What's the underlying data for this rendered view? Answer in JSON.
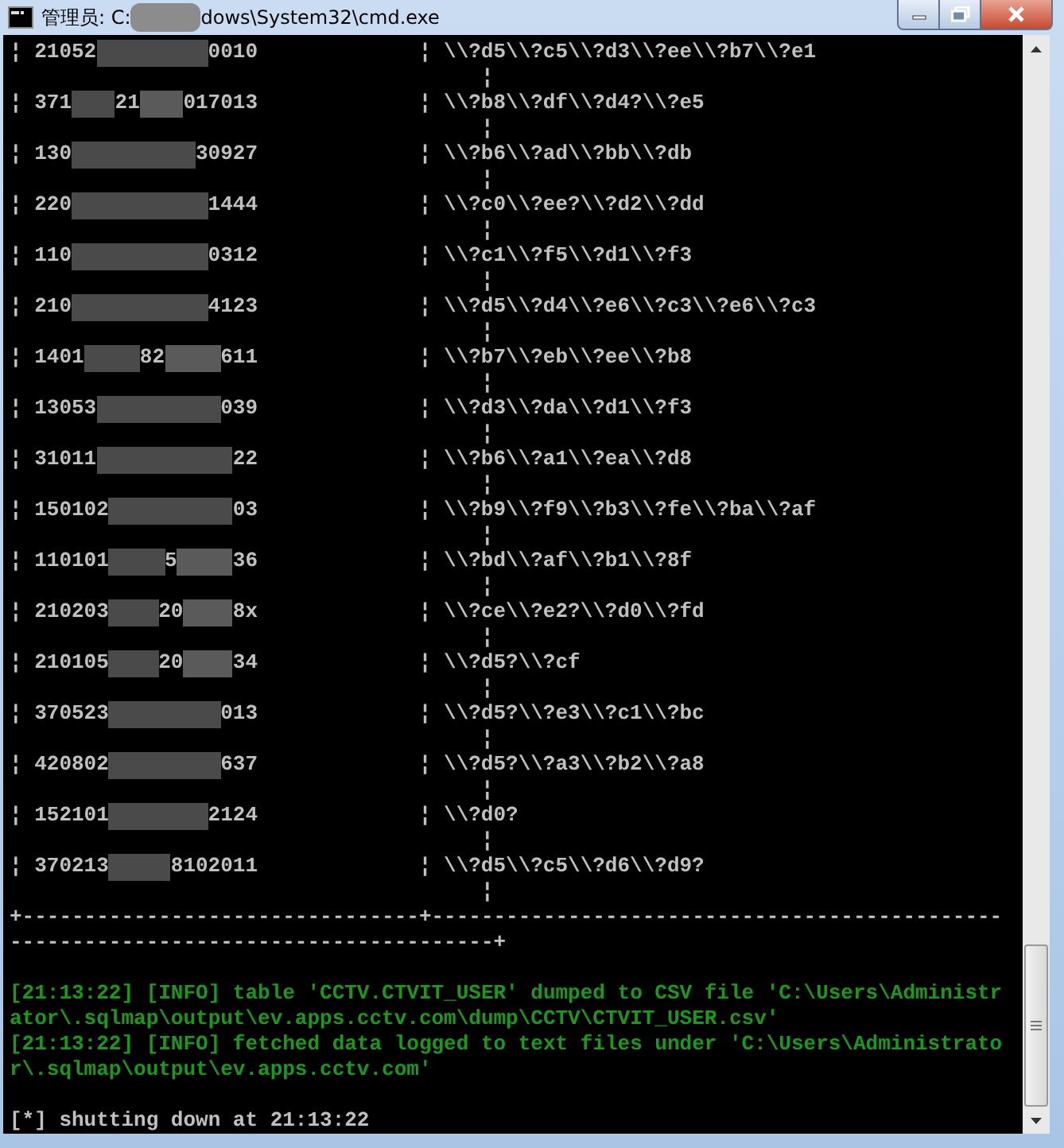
{
  "window": {
    "title_parts": [
      "管理员: C:",
      "dows\\System32\\cmd.exe"
    ],
    "controls": [
      {
        "kind": "minimize"
      },
      {
        "kind": "maximize"
      },
      {
        "kind": "close"
      }
    ]
  },
  "table": {
    "rows": [
      {
        "left": "¦",
        "id": [
          "21052",
          "0010"
        ],
        "mid": "¦",
        "value": "\\\\?d5\\\\?c5\\\\?d3\\\\?ee\\\\?b7\\\\?e1",
        "wrap": "¦"
      },
      {
        "left": "¦",
        "id": [
          "371",
          "21",
          "017013"
        ],
        "mid": "¦",
        "value": "\\\\?b8\\\\?df\\\\?d4?\\\\?e5",
        "wrap": "¦"
      },
      {
        "left": "¦",
        "id": [
          "130",
          "30927"
        ],
        "mid": "¦",
        "value": "\\\\?b6\\\\?ad\\\\?bb\\\\?db",
        "wrap": "¦"
      },
      {
        "left": "¦",
        "id": [
          "220",
          "1444"
        ],
        "mid": "¦",
        "value": "\\\\?c0\\\\?ee?\\\\?d2\\\\?dd",
        "wrap": "¦"
      },
      {
        "left": "¦",
        "id": [
          "110",
          "0312"
        ],
        "mid": "¦",
        "value": "\\\\?c1\\\\?f5\\\\?d1\\\\?f3",
        "wrap": "¦"
      },
      {
        "left": "¦",
        "id": [
          "210",
          "4123"
        ],
        "mid": "¦",
        "value": "\\\\?d5\\\\?d4\\\\?e6\\\\?c3\\\\?e6\\\\?c3",
        "wrap": "¦"
      },
      {
        "left": "¦",
        "id": [
          "1401",
          "82",
          "611"
        ],
        "mid": "¦",
        "value": "\\\\?b7\\\\?eb\\\\?ee\\\\?b8",
        "wrap": "¦"
      },
      {
        "left": "¦",
        "id": [
          "13053",
          "039"
        ],
        "mid": "¦",
        "value": "\\\\?d3\\\\?da\\\\?d1\\\\?f3",
        "wrap": "¦"
      },
      {
        "left": "¦",
        "id": [
          "31011",
          "22"
        ],
        "mid": "¦",
        "value": "\\\\?b6\\\\?a1\\\\?ea\\\\?d8",
        "wrap": "¦"
      },
      {
        "left": "¦",
        "id": [
          "150102",
          "03"
        ],
        "mid": "¦",
        "value": "\\\\?b9\\\\?f9\\\\?b3\\\\?fe\\\\?ba\\\\?af",
        "wrap": "¦"
      },
      {
        "left": "¦",
        "id": [
          "110101",
          "5",
          "36"
        ],
        "mid": "¦",
        "value": "\\\\?bd\\\\?af\\\\?b1\\\\?8f",
        "wrap": "¦"
      },
      {
        "left": "¦",
        "id": [
          "210203",
          "20",
          "8x"
        ],
        "mid": "¦",
        "value": "\\\\?ce\\\\?e2?\\\\?d0\\\\?fd",
        "wrap": "¦"
      },
      {
        "left": "¦",
        "id": [
          "210105",
          "20",
          "34"
        ],
        "mid": "¦",
        "value": "\\\\?d5?\\\\?cf",
        "wrap": "¦"
      },
      {
        "left": "¦",
        "id": [
          "370523",
          "013"
        ],
        "mid": "¦",
        "value": "\\\\?d5?\\\\?e3\\\\?c1\\\\?bc",
        "wrap": "¦"
      },
      {
        "left": "¦",
        "id": [
          "420802",
          "637"
        ],
        "mid": "¦",
        "value": "\\\\?d5?\\\\?a3\\\\?b2\\\\?a8",
        "wrap": "¦"
      },
      {
        "left": "¦",
        "id": [
          "152101",
          "2124"
        ],
        "mid": "¦",
        "value": "\\\\?d0?",
        "wrap": "¦"
      },
      {
        "left": "¦",
        "id": [
          "370213",
          "8102011"
        ],
        "mid": "¦",
        "value": "\\\\?d5\\\\?c5\\\\?d6\\\\?d9?",
        "wrap": "¦"
      }
    ],
    "border": "+--------------------------------+-------------------------------------------------------------------------------------+"
  },
  "log": [
    {
      "kind": "info",
      "text": "[21:13:22] [INFO] table 'CCTV.CTVIT_USER' dumped to CSV file 'C:\\Users\\Administrator\\.sqlmap\\output\\ev.apps.cctv.com\\dump\\CCTV\\CTVIT_USER.csv'"
    },
    {
      "kind": "info",
      "text": "[21:13:22] [INFO] fetched data logged to text files under 'C:\\Users\\Administrator\\.sqlmap\\output\\ev.apps.cctv.com'"
    },
    {
      "kind": "blank"
    },
    {
      "kind": "plain",
      "text": "[*] shutting down at 21:13:22"
    }
  ]
}
